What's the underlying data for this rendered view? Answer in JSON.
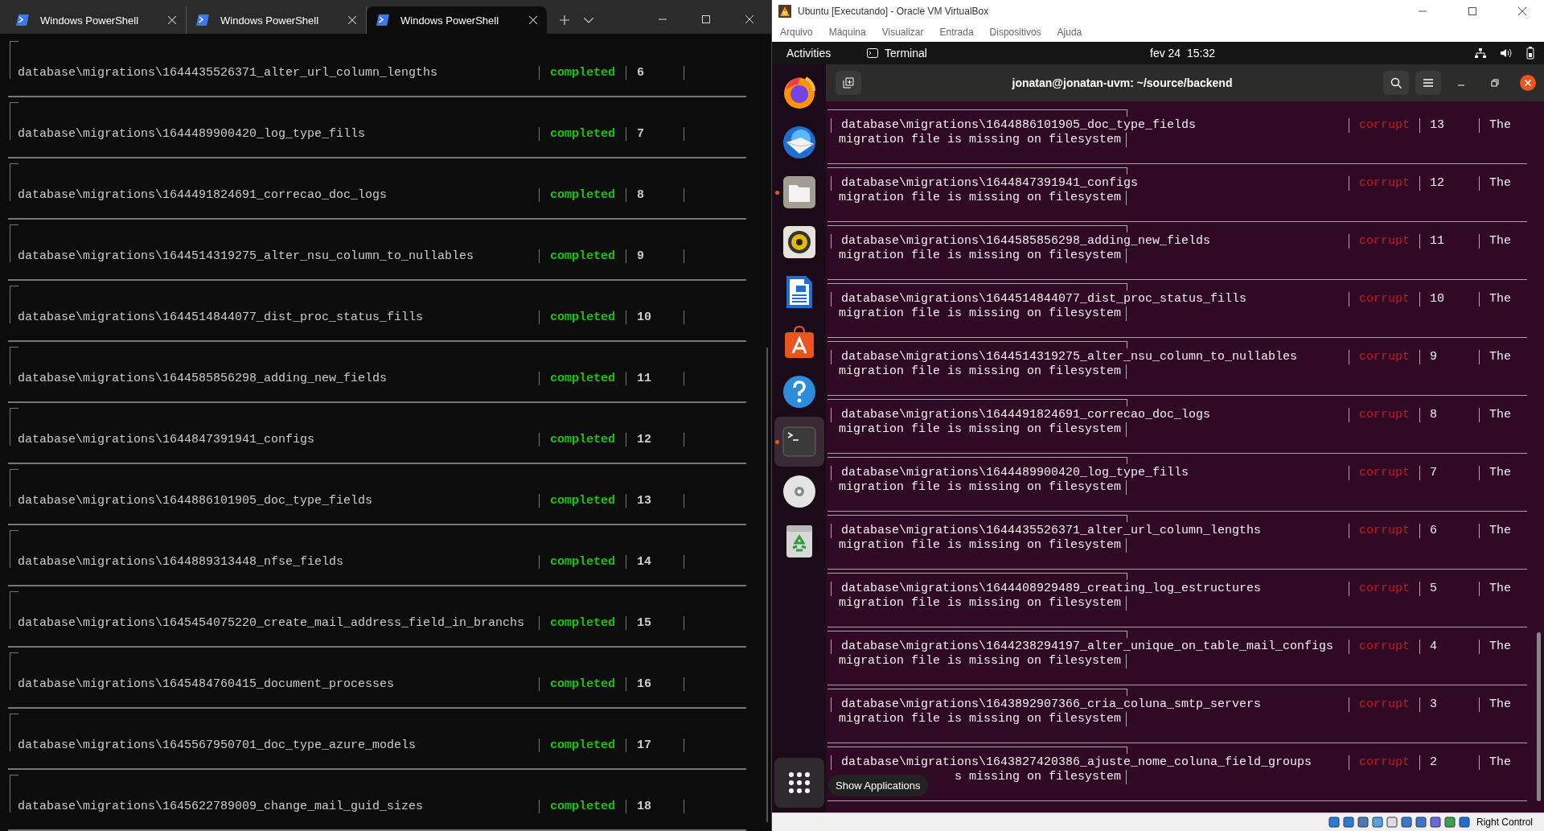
{
  "powershell": {
    "tabs": [
      {
        "title": "Windows PowerShell",
        "selected": false
      },
      {
        "title": "Windows PowerShell",
        "selected": false
      },
      {
        "title": "Windows PowerShell",
        "selected": true
      }
    ],
    "rows": [
      {
        "name": "database\\migrations\\1644435526371_alter_url_column_lengths",
        "status": "completed",
        "kind": "success",
        "number": "6"
      },
      {
        "name": "database\\migrations\\1644489900420_log_type_fills",
        "status": "completed",
        "kind": "success",
        "number": "7"
      },
      {
        "name": "database\\migrations\\1644491824691_correcao_doc_logs",
        "status": "completed",
        "kind": "success",
        "number": "8"
      },
      {
        "name": "database\\migrations\\1644514319275_alter_nsu_column_to_nullables",
        "status": "completed",
        "kind": "success",
        "number": "9"
      },
      {
        "name": "database\\migrations\\1644514844077_dist_proc_status_fills",
        "status": "completed",
        "kind": "success",
        "number": "10"
      },
      {
        "name": "database\\migrations\\1644585856298_adding_new_fields",
        "status": "completed",
        "kind": "success",
        "number": "11"
      },
      {
        "name": "database\\migrations\\1644847391941_configs",
        "status": "completed",
        "kind": "success",
        "number": "12"
      },
      {
        "name": "database\\migrations\\1644886101905_doc_type_fields",
        "status": "completed",
        "kind": "success",
        "number": "13"
      },
      {
        "name": "database\\migrations\\1644889313448_nfse_fields",
        "status": "completed",
        "kind": "success",
        "number": "14"
      },
      {
        "name": "database\\migrations\\1645454075220_create_mail_address_field_in_branchs",
        "status": "completed",
        "kind": "success",
        "number": "15"
      },
      {
        "name": "database\\migrations\\1645484760415_document_processes",
        "status": "completed",
        "kind": "success",
        "number": "16"
      },
      {
        "name": "database\\migrations\\1645567950701_doc_type_azure_models",
        "status": "completed",
        "kind": "success",
        "number": "17"
      },
      {
        "name": "database\\migrations\\1645622789009_change_mail_guid_sizes",
        "status": "completed",
        "kind": "success",
        "number": "18"
      }
    ]
  },
  "virtualbox": {
    "title": "Ubuntu [Executando] - Oracle VM VirtualBox",
    "menu": [
      "Arquivo",
      "Máquina",
      "Visualizar",
      "Entrada",
      "Dispositivos",
      "Ajuda"
    ],
    "status_text": "Right Control"
  },
  "ubuntu": {
    "activities": "Activities",
    "app": "Terminal",
    "clock": "fev 24  15:32",
    "dock": [
      {
        "kind": "browser",
        "running": false,
        "selected": false
      },
      {
        "kind": "mail",
        "running": false,
        "selected": false
      },
      {
        "kind": "files",
        "running": true,
        "selected": false
      },
      {
        "kind": "music",
        "running": false,
        "selected": false
      },
      {
        "kind": "writer",
        "running": false,
        "selected": false
      },
      {
        "kind": "store",
        "running": false,
        "selected": false
      },
      {
        "kind": "help",
        "running": false,
        "selected": false
      },
      {
        "kind": "terminal",
        "running": true,
        "selected": true
      },
      {
        "kind": "disc",
        "running": false,
        "selected": false
      },
      {
        "kind": "trash",
        "running": false,
        "selected": false
      }
    ],
    "tooltip": "Show Applications"
  },
  "terminal": {
    "title": "jonatan@jonatan-uvm: ~/source/backend",
    "rows": [
      {
        "name": "database\\migrations\\1644886101905_doc_type_fields",
        "status": "corrupt",
        "kind": "error",
        "number": "13",
        "message": "The",
        "detail": "migration file is missing on filesystem"
      },
      {
        "name": "database\\migrations\\1644847391941_configs",
        "status": "corrupt",
        "kind": "error",
        "number": "12",
        "message": "The",
        "detail": "migration file is missing on filesystem"
      },
      {
        "name": "database\\migrations\\1644585856298_adding_new_fields",
        "status": "corrupt",
        "kind": "error",
        "number": "11",
        "message": "The",
        "detail": "migration file is missing on filesystem"
      },
      {
        "name": "database\\migrations\\1644514844077_dist_proc_status_fills",
        "status": "corrupt",
        "kind": "error",
        "number": "10",
        "message": "The",
        "detail": "migration file is missing on filesystem"
      },
      {
        "name": "database\\migrations\\1644514319275_alter_nsu_column_to_nullables",
        "status": "corrupt",
        "kind": "error",
        "number": "9",
        "message": "The",
        "detail": "migration file is missing on filesystem"
      },
      {
        "name": "database\\migrations\\1644491824691_correcao_doc_logs",
        "status": "corrupt",
        "kind": "error",
        "number": "8",
        "message": "The",
        "detail": "migration file is missing on filesystem"
      },
      {
        "name": "database\\migrations\\1644489900420_log_type_fills",
        "status": "corrupt",
        "kind": "error",
        "number": "7",
        "message": "The",
        "detail": "migration file is missing on filesystem"
      },
      {
        "name": "database\\migrations\\1644435526371_alter_url_column_lengths",
        "status": "corrupt",
        "kind": "error",
        "number": "6",
        "message": "The",
        "detail": "migration file is missing on filesystem"
      },
      {
        "name": "database\\migrations\\1644408929489_creating_log_estructures",
        "status": "corrupt",
        "kind": "error",
        "number": "5",
        "message": "The",
        "detail": "migration file is missing on filesystem"
      },
      {
        "name": "database\\migrations\\1644238294197_alter_unique_on_table_mail_configs",
        "status": "corrupt",
        "kind": "error",
        "number": "4",
        "message": "The",
        "detail": "migration file is missing on filesystem"
      },
      {
        "name": "database\\migrations\\1643892907366_cria_coluna_smtp_servers",
        "status": "corrupt",
        "kind": "error",
        "number": "3",
        "message": "The",
        "detail": "migration file is missing on filesystem"
      },
      {
        "name": "database\\migrations\\1643827420386_ajuste_nome_coluna_field_groups",
        "status": "corrupt",
        "kind": "error",
        "number": "2",
        "message": "The",
        "detail": "s missing on filesystem"
      }
    ]
  }
}
